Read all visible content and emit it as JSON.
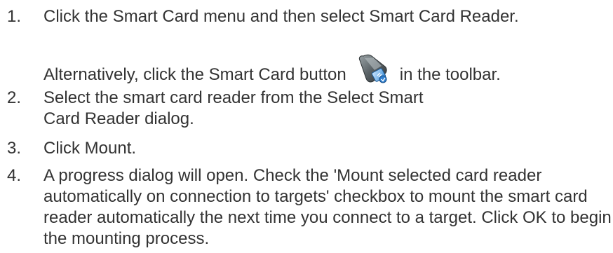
{
  "steps": [
    {
      "number": "1.",
      "text": "Click the Smart Card menu and then select Smart Card Reader.",
      "sub_before": "Alternatively, click the Smart Card button",
      "icon": "smart-card-reader-icon",
      "sub_after": "in the toolbar."
    },
    {
      "number": "2.",
      "text": "Select the smart card reader from the Select Smart Card Reader dialog."
    },
    {
      "number": "3.",
      "text": "Click Mount."
    },
    {
      "number": "4.",
      "text": "A progress dialog will open. Check the 'Mount selected card reader automatically on connection to targets' checkbox to mount the smart card reader automatically the next time you connect to a target. Click OK to begin the mounting process."
    }
  ]
}
